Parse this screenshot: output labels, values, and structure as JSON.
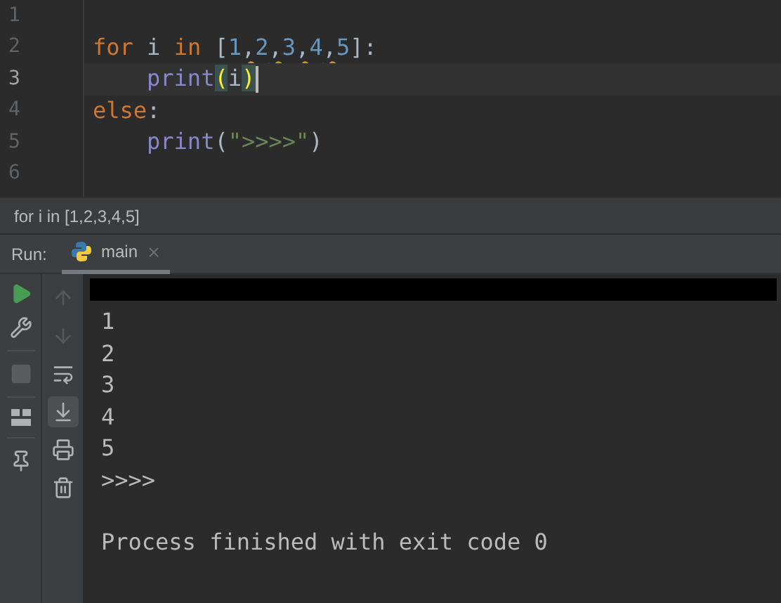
{
  "editor": {
    "lines": [
      {
        "number": "1",
        "current": false
      },
      {
        "number": "2",
        "current": false,
        "tokens": [
          {
            "kind": "keyword",
            "text": "for"
          },
          {
            "kind": "plain",
            "text": " i "
          },
          {
            "kind": "keyword",
            "text": "in"
          },
          {
            "kind": "plain",
            "text": " ["
          },
          {
            "kind": "number",
            "text": "1"
          },
          {
            "kind": "warn",
            "text": ","
          },
          {
            "kind": "number",
            "text": "2"
          },
          {
            "kind": "warn",
            "text": ","
          },
          {
            "kind": "number",
            "text": "3"
          },
          {
            "kind": "warn",
            "text": ","
          },
          {
            "kind": "number",
            "text": "4"
          },
          {
            "kind": "warn",
            "text": ","
          },
          {
            "kind": "number",
            "text": "5"
          },
          {
            "kind": "plain",
            "text": "]:"
          }
        ]
      },
      {
        "number": "3",
        "current": true,
        "indented": true,
        "tokens": [
          {
            "kind": "builtin",
            "text": "print"
          },
          {
            "kind": "match",
            "text": "("
          },
          {
            "kind": "plain",
            "text": "i"
          },
          {
            "kind": "match",
            "text": ")"
          }
        ]
      },
      {
        "number": "4",
        "current": false,
        "tokens": [
          {
            "kind": "keyword",
            "text": "else"
          },
          {
            "kind": "plain",
            "text": ":"
          }
        ]
      },
      {
        "number": "5",
        "current": false,
        "indented": true,
        "tokens": [
          {
            "kind": "builtin",
            "text": "print"
          },
          {
            "kind": "plain",
            "text": "("
          },
          {
            "kind": "string",
            "text": "\">>>>\""
          },
          {
            "kind": "plain",
            "text": ")"
          }
        ]
      },
      {
        "number": "6",
        "current": false
      }
    ]
  },
  "breadcrumb": "for i in [1,2,3,4,5]",
  "run_panel": {
    "label": "Run:",
    "tabs": [
      {
        "label": "main",
        "selected": true
      }
    ],
    "left_toolbar": [
      {
        "kind": "run",
        "disabled": false
      },
      {
        "kind": "wrench",
        "disabled": false
      },
      {
        "kind": "stop",
        "disabled": true
      },
      {
        "kind": "layout",
        "disabled": false
      },
      {
        "kind": "pin",
        "disabled": false
      }
    ],
    "console_toolbar": [
      {
        "kind": "up",
        "disabled": true,
        "selected": false
      },
      {
        "kind": "down",
        "disabled": true,
        "selected": false
      },
      {
        "kind": "wrap",
        "disabled": false,
        "selected": false
      },
      {
        "kind": "scroll-end",
        "disabled": false,
        "selected": true
      },
      {
        "kind": "print",
        "disabled": false,
        "selected": false
      },
      {
        "kind": "trash",
        "disabled": false,
        "selected": false
      }
    ],
    "output": [
      "1",
      "2",
      "3",
      "4",
      "5",
      ">>>>"
    ],
    "exit_message": "Process finished with exit code 0"
  }
}
